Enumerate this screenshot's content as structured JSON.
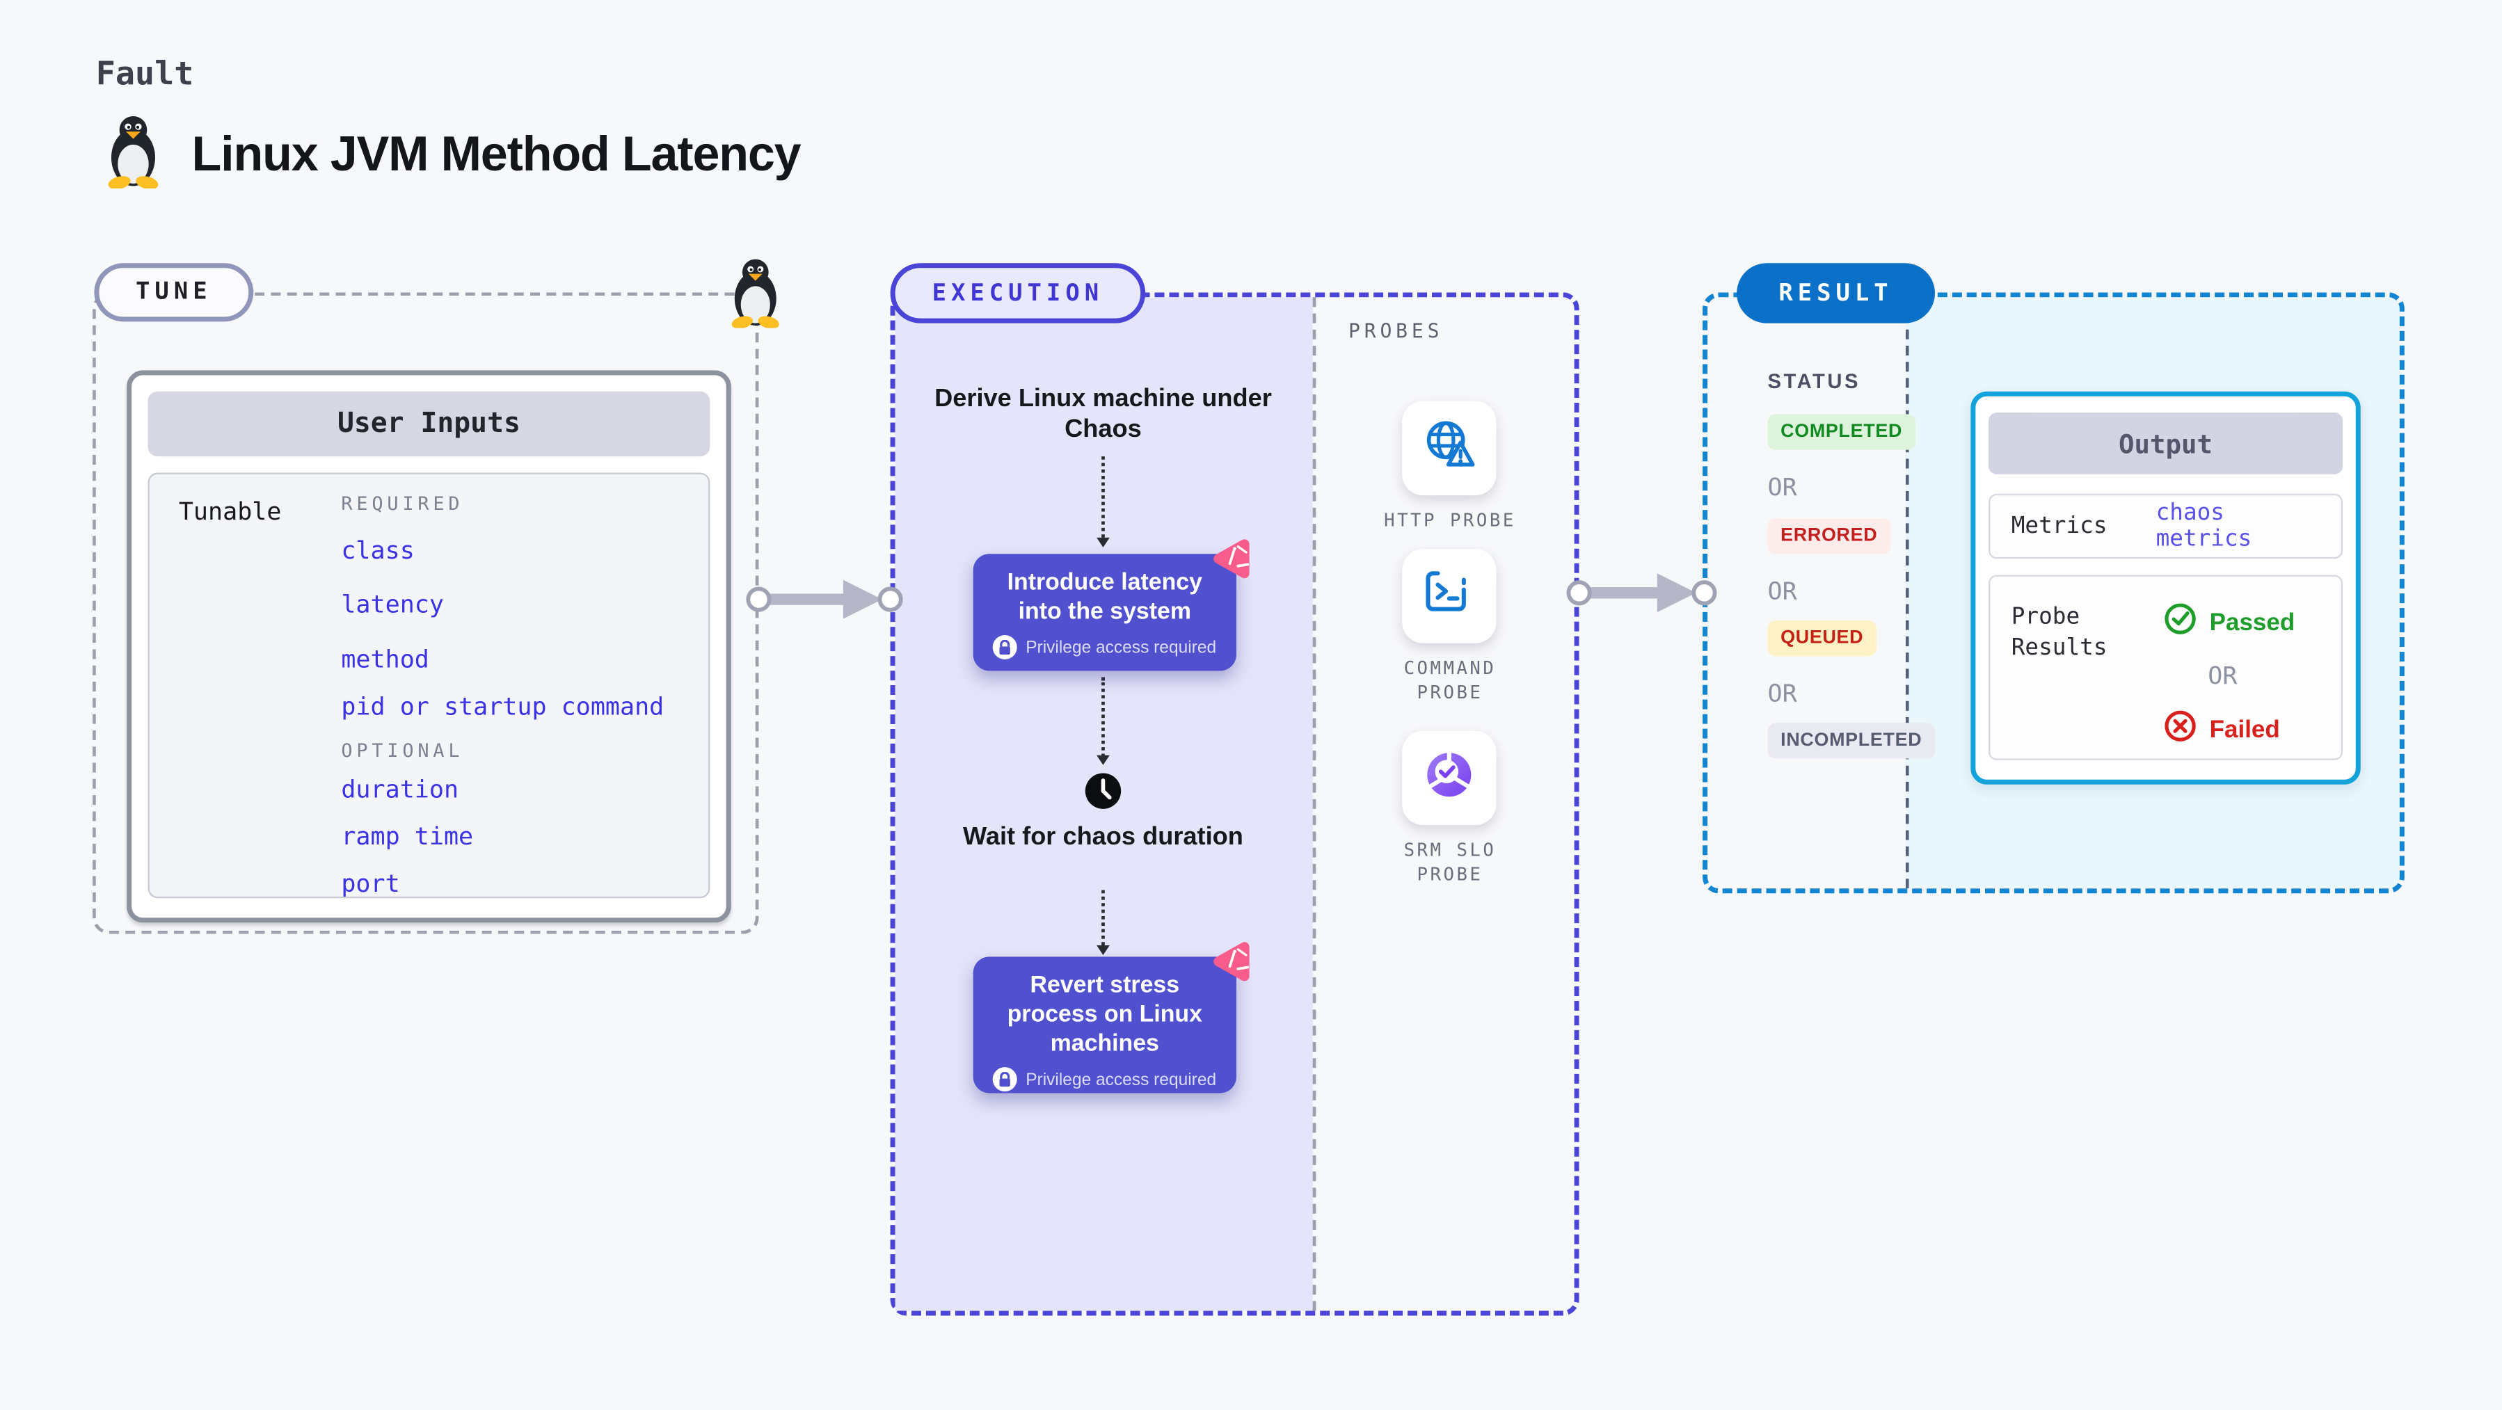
{
  "page": {
    "kicker": "Fault",
    "title": "Linux JVM Method Latency"
  },
  "icons": {
    "penguin": "linux-tux",
    "lock": "privilege-lock",
    "clock": "wait-clock",
    "chaos_badge": "chaos-pink-triangle"
  },
  "colors": {
    "background": "#f7f8fa",
    "execution_fill": "#e4e4fa",
    "execution_border": "#4a45d6",
    "fault_box": "#5150ce",
    "chaos_pink": "#f85c8c",
    "result_border": "#1285d2",
    "result_badge": "#0a70c8",
    "output_panel_fill": "#e9f6fc",
    "output_card_border": "#13a3da",
    "probe_icon_blue": "#1479d2",
    "link_indigo": "#3a32e4",
    "passed_green": "#1f9d2a",
    "failed_red": "#d8201c"
  },
  "tune": {
    "badge": "TUNE",
    "panel_title": "User Inputs",
    "row_label": "Tunable",
    "required_label": "REQUIRED",
    "required_items": [
      "class",
      "latency",
      "method",
      "pid or startup command"
    ],
    "optional_label": "OPTIONAL",
    "optional_items": [
      "duration",
      "ramp time",
      "port"
    ]
  },
  "execution": {
    "badge": "EXECUTION",
    "step_derive": "Derive Linux machine under Chaos",
    "fault_boxes": [
      {
        "label": "Introduce latency into the system",
        "note": "Privilege access required"
      },
      {
        "label": "Revert stress process on Linux machines",
        "note": "Privilege access required"
      }
    ],
    "step_wait": "Wait for chaos duration"
  },
  "probes": {
    "label": "PROBES",
    "items": [
      {
        "name": "HTTP PROBE",
        "icon": "globe-alert-icon"
      },
      {
        "name": "COMMAND\nPROBE",
        "icon": "terminal-icon"
      },
      {
        "name": "SRM SLO\nPROBE",
        "icon": "slo-donut-check-icon"
      }
    ]
  },
  "result": {
    "badge": "RESULT",
    "status_label": "STATUS",
    "or": "OR",
    "statuses": [
      {
        "label": "COMPLETED",
        "fg": "#118a22",
        "bg": "#ddf3dc"
      },
      {
        "label": "ERRORED",
        "fg": "#c41f1f",
        "bg": "#fcecea"
      },
      {
        "label": "QUEUED",
        "fg": "#c42015",
        "bg": "#fdf2c5"
      },
      {
        "label": "INCOMPLETED",
        "fg": "#575b70",
        "bg": "#e9e9f1"
      }
    ],
    "output": {
      "title": "Output",
      "metrics_label": "Metrics",
      "metrics_value": "chaos metrics",
      "probe_results_label": "Probe Results",
      "passed": "Passed",
      "or": "OR",
      "failed": "Failed"
    }
  }
}
